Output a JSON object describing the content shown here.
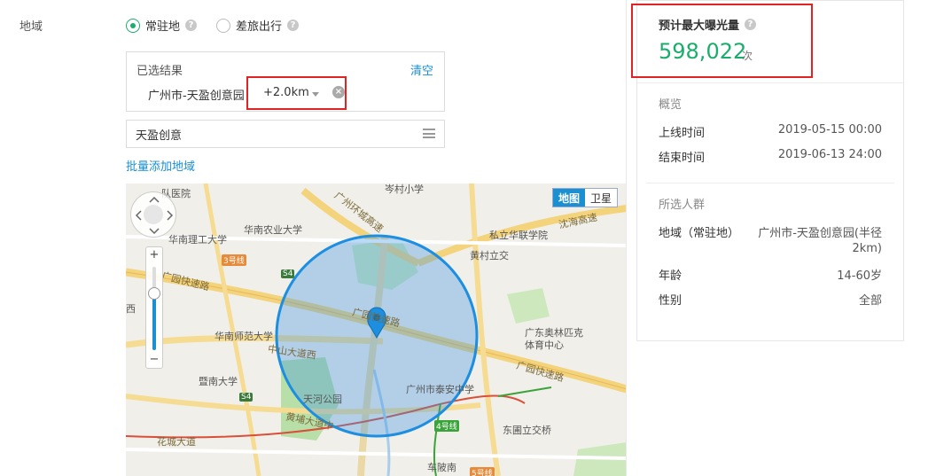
{
  "region": {
    "label": "地域",
    "options": [
      {
        "label": "常驻地",
        "checked": true
      },
      {
        "label": "差旅出行",
        "checked": false
      }
    ]
  },
  "selected": {
    "title": "已选结果",
    "clear": "清空",
    "tag": "广州市-天盈创意园",
    "radius": "+2.0km"
  },
  "search": {
    "value": "天盈创意"
  },
  "batch_add": "批量添加地域",
  "map": {
    "type_map": "地图",
    "type_sat": "卫星",
    "zoom_level_fraction": 0.68,
    "labels": {
      "hospital": "队医院",
      "school1": "岑村小学",
      "agri": "华南农业大学",
      "scut": "华南理工大学",
      "metro3": "3号线",
      "s4a": "S4",
      "road_ring": "广州环城高速",
      "expressway1": "广园快速路",
      "scnu": "华南师范大学",
      "zhongshan": "中山大道西",
      "xi": "西",
      "jnu": "暨南大学",
      "s4b": "S4",
      "tianhe": "天河公园",
      "huangpu": "黄埔大道中",
      "huacheng": "花城大道",
      "metro4": "4号线",
      "chebei": "车陂南",
      "metro5": "5号线",
      "taian": "广州市泰安中学",
      "dongpu": "东圃立交桥",
      "olympic1": "广东奥林匹克",
      "olympic2": "体育中心",
      "huafu": "私立华联学院",
      "huangcun": "黄村立交",
      "shenhai": "沈海高速",
      "expressway2": "广园快速路",
      "expressway3": "广园快速路"
    }
  },
  "summary": {
    "est_title": "预计最大曝光量",
    "est_value": "598,022",
    "est_unit": "次",
    "overview_title": "概览",
    "start_label": "上线时间",
    "start_value": "2019-05-15 00:00",
    "end_label": "结束时间",
    "end_value": "2019-06-13 24:00",
    "audience_title": "所选人群",
    "area_label": "地域（常驻地）",
    "area_value_line1": "广州市-天盈创意园(半径",
    "area_value_line2": "2km)",
    "age_label": "年龄",
    "age_value": "14-60岁",
    "gender_label": "性别",
    "gender_value": "全部"
  },
  "colors": {
    "accent_green": "#1aad6b",
    "link_blue": "#1a8fd1",
    "highlight_red": "#e02424"
  }
}
